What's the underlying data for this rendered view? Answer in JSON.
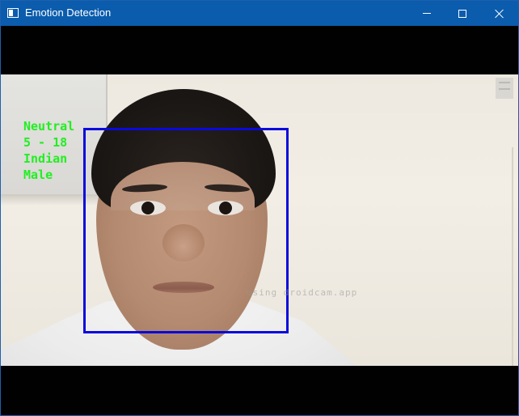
{
  "window": {
    "title": "Emotion Detection",
    "icon": "app-window-icon",
    "controls": {
      "minimize": "minimize-icon",
      "maximize": "maximize-icon",
      "close": "close-icon"
    },
    "titlebar_color": "#0b5cad"
  },
  "video": {
    "overlay_lines": [
      "Neutral",
      "5 - 18",
      "Indian",
      "Male"
    ],
    "overlay_color": "#22ee22",
    "face_box_color": "#0a0adc",
    "watermark": "using droidcam.app"
  }
}
